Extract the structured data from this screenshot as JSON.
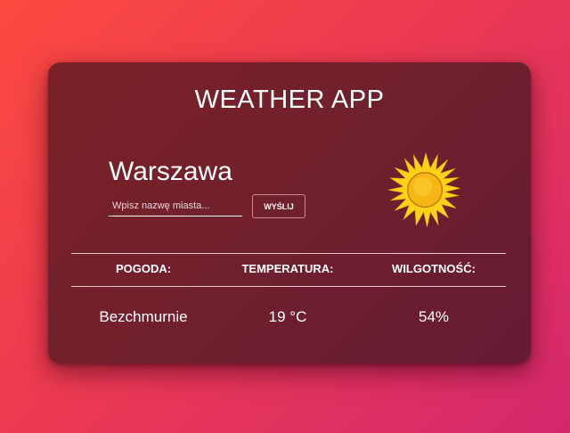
{
  "app": {
    "title": "WEATHER APP"
  },
  "location": {
    "city": "Warszawa"
  },
  "search": {
    "placeholder": "Wpisz nazwę miasta...",
    "value": "",
    "submit_label": "WYŚLIJ"
  },
  "current_icon": "sun-icon",
  "table": {
    "headers": {
      "condition": "POGODA:",
      "temperature": "TEMPERATURA:",
      "humidity": "WILGOTNOŚĆ:"
    },
    "values": {
      "condition": "Bezchmurnie",
      "temperature": "19 °C",
      "humidity": "54%"
    }
  },
  "colors": {
    "background_start": "#fb4a3f",
    "background_end": "#d4286e",
    "card": "#70202d",
    "sun": "#ffd21a",
    "text": "#ffffff"
  }
}
